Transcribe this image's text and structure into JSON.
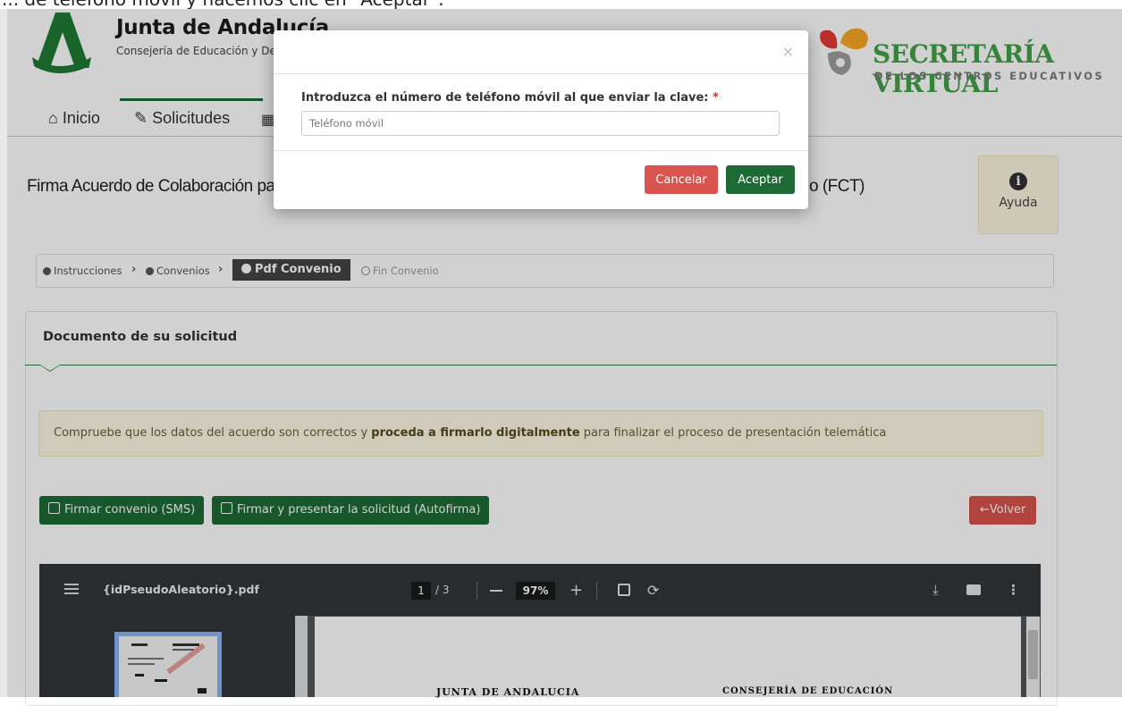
{
  "caption": "... de teléfono móvil y hacemos clic en \"Aceptar\".",
  "header": {
    "org_title": "Junta de Andalucía",
    "org_subtitle": "Consejería de Educación y Deporte",
    "brand_title": "SECRETARÍA VIRTUAL",
    "brand_subtitle": "DE LOS CENTROS EDUCATIVOS"
  },
  "nav": {
    "items": [
      {
        "label": "Inicio",
        "icon": "home-icon"
      },
      {
        "label": "Solicitudes",
        "icon": "pencil-icon"
      }
    ]
  },
  "page": {
    "title": "Firma Acuerdo de Colaboración para la Formación en Centros de Trabajo (FCT)",
    "title_visible_left": "Firma Acuerdo de Colaboración pa",
    "title_visible_right": "o (FCT)",
    "help_label": "Ayuda"
  },
  "steps": [
    {
      "label": "Instrucciones",
      "state": "done"
    },
    {
      "label": "Convenios",
      "state": "done"
    },
    {
      "label": "Pdf Convenio",
      "state": "active"
    },
    {
      "label": "Fin Convenio",
      "state": "pending"
    }
  ],
  "panel": {
    "title": "Documento de su solicitud",
    "alert_prefix": "Compruebe que los datos del acuerdo son correctos y ",
    "alert_bold": "proceda a firmarlo digitalmente",
    "alert_suffix": " para finalizar el proceso de presentación telemática",
    "btn_sms": "Firmar convenio (SMS)",
    "btn_autofirma": "Firmar y presentar la solicitud (Autofirma)",
    "btn_back": "Volver"
  },
  "pdf_viewer": {
    "filename": "{idPseudoAleatorio}.pdf",
    "current_page": "1",
    "page_of": "/ 3",
    "zoom": "97%",
    "doc_heading_left": "JUNTA DE ANDALUCIA",
    "doc_heading_right": "CONSEJERÍA DE EDUCACIÓN"
  },
  "modal": {
    "close_label": "×",
    "label": "Introduzca el número de teléfono móvil al que enviar la clave:",
    "required_mark": "*",
    "input_placeholder": "Teléfono móvil",
    "input_value": "",
    "cancel_label": "Cancelar",
    "accept_label": "Aceptar"
  },
  "colors": {
    "primary_green": "#1e6a36",
    "danger_red": "#d9534f",
    "brand_green": "#43a047",
    "alert_bg": "#fcf8e3"
  }
}
